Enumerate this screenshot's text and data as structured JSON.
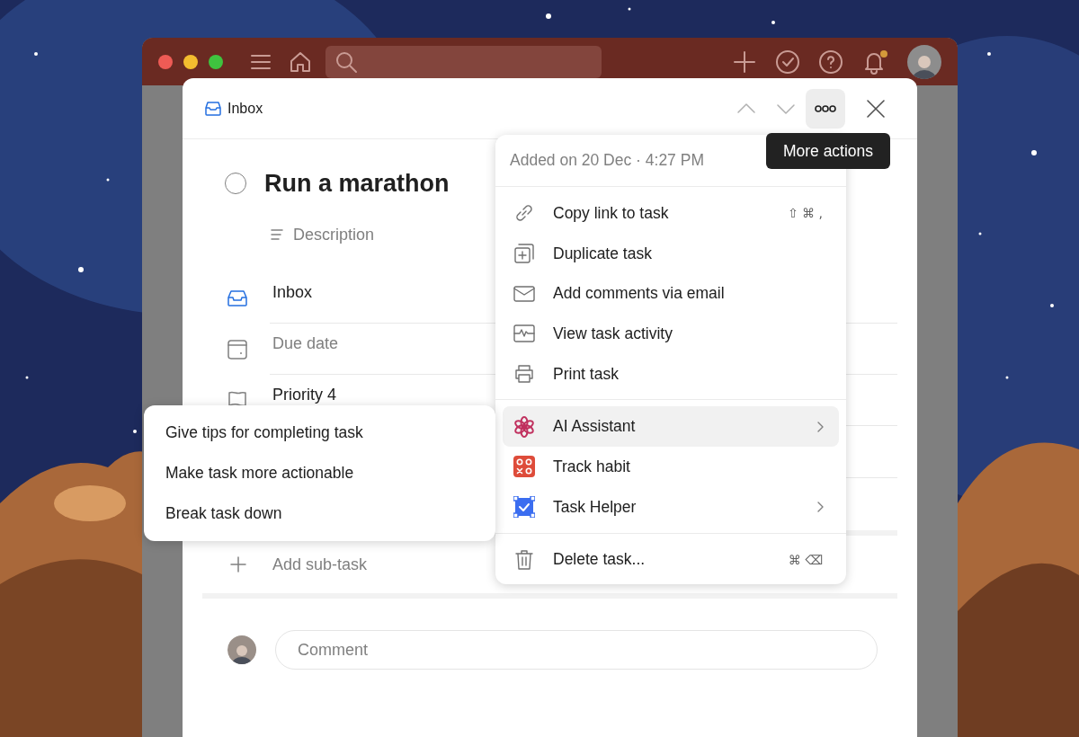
{
  "toolbar": {
    "notifications": true
  },
  "header": {
    "project": "Inbox",
    "more_button": {
      "pressed": true
    }
  },
  "tooltip": "More actions",
  "task": {
    "title": "Run a marathon",
    "completed": false,
    "description_placeholder": "Description",
    "attributes": [
      {
        "label": "Inbox",
        "set": true
      },
      {
        "label": "Due date",
        "set": false
      },
      {
        "label": "Priority 4",
        "set": true
      }
    ],
    "add_subtask": "Add sub-task",
    "comment": {
      "placeholder": "Comment"
    }
  },
  "menu": {
    "header": "Added on 20 Dec · 4:27 PM",
    "groups": [
      {
        "items": [
          {
            "label": "Copy link to task",
            "shortcut": "⇧ ⌘ ,",
            "submenu": false,
            "selected": false
          },
          {
            "label": "Duplicate task",
            "submenu": false,
            "selected": false
          },
          {
            "label": "Add comments via email",
            "submenu": false,
            "selected": false
          },
          {
            "label": "View task activity",
            "submenu": false,
            "selected": false
          },
          {
            "label": "Print task",
            "submenu": false,
            "selected": false
          }
        ]
      },
      {
        "items": [
          {
            "label": "AI Assistant",
            "submenu": true,
            "selected": true
          },
          {
            "label": "Track habit",
            "submenu": false,
            "selected": false
          },
          {
            "label": "Task Helper",
            "submenu": true,
            "selected": false
          }
        ]
      },
      {
        "items": [
          {
            "label": "Delete task...",
            "shortcut": "⌘ ⌫",
            "submenu": false,
            "selected": false
          }
        ]
      }
    ]
  },
  "submenu": {
    "items": [
      {
        "label": "Give tips for completing task",
        "selected": false
      },
      {
        "label": "Make task more actionable",
        "selected": false
      },
      {
        "label": "Break task down",
        "selected": false
      }
    ]
  }
}
